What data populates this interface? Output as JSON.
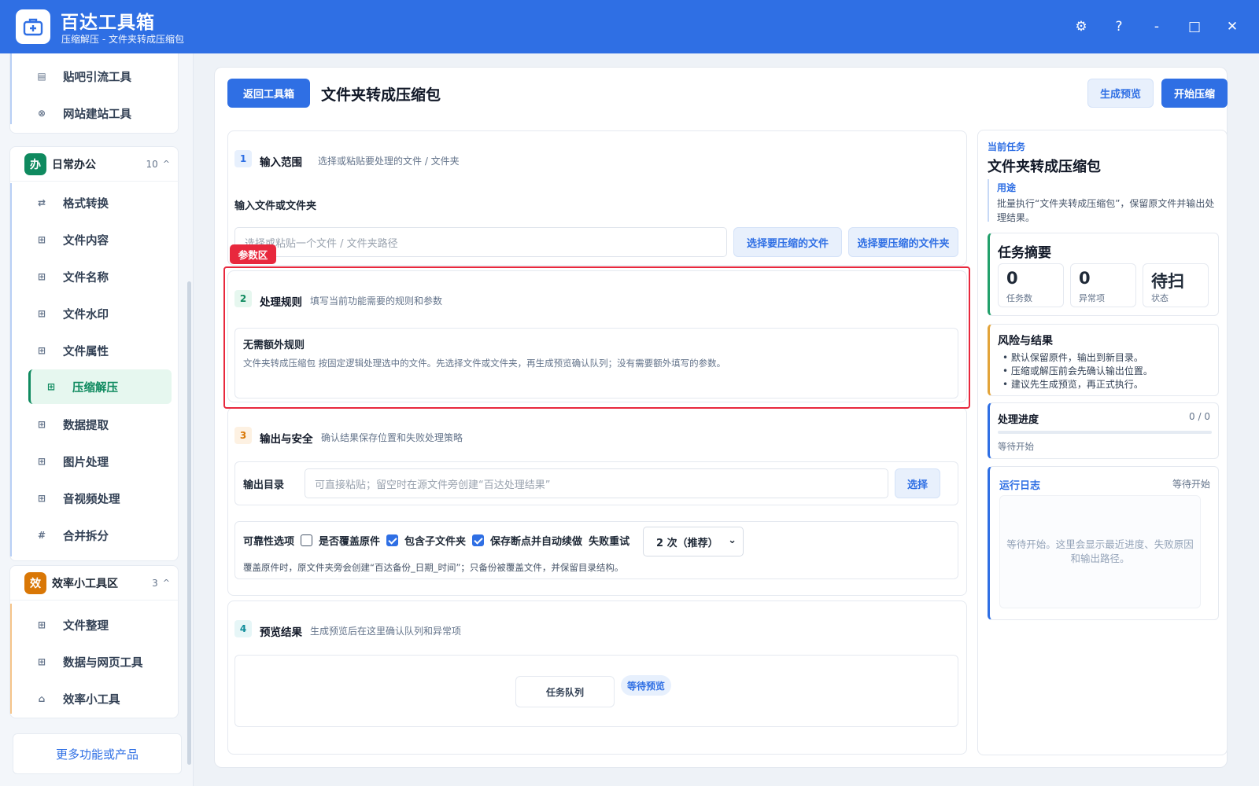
{
  "app": {
    "title": "百达工具箱",
    "subtitle": "压缩解压 - 文件夹转成压缩包",
    "controls": {
      "settings": "⚙",
      "help": "?",
      "minimize": "-",
      "maximize": "□",
      "close": "✕"
    }
  },
  "sidebar": {
    "top_items": [
      {
        "label": "贴吧引流工具",
        "icon": "▤"
      },
      {
        "label": "网站建站工具",
        "icon": "⊗"
      }
    ],
    "groups": [
      {
        "badge": "办",
        "badge_color": "#0f8a5f",
        "name": "日常办公",
        "count": "10",
        "caret": "^",
        "items": [
          {
            "label": "格式转换",
            "icon": "⇄"
          },
          {
            "label": "文件内容",
            "icon": "⊞"
          },
          {
            "label": "文件名称",
            "icon": "⊞"
          },
          {
            "label": "文件水印",
            "icon": "⊞"
          },
          {
            "label": "文件属性",
            "icon": "⊞"
          },
          {
            "label": "压缩解压",
            "icon": "⊞",
            "active": true
          },
          {
            "label": "数据提取",
            "icon": "⊞"
          },
          {
            "label": "图片处理",
            "icon": "⊞"
          },
          {
            "label": "音视频处理",
            "icon": "⊞"
          },
          {
            "label": "合并拆分",
            "icon": "#"
          }
        ]
      },
      {
        "badge": "效",
        "badge_color": "#d97706",
        "name": "效率小工具区",
        "count": "3",
        "caret": "^",
        "items": [
          {
            "label": "文件整理",
            "icon": "⊞"
          },
          {
            "label": "数据与网页工具",
            "icon": "⊞"
          },
          {
            "label": "效率小工具",
            "icon": "⌂"
          }
        ]
      }
    ],
    "more": "更多功能或产品"
  },
  "main": {
    "back_button": "返回工具箱",
    "title": "文件夹转成压缩包",
    "preview_button": "生成预览",
    "start_button": "开始压缩",
    "section1": {
      "num": "1",
      "title": "输入范围",
      "desc": "选择或粘贴要处理的文件 / 文件夹",
      "field_label": "输入文件或文件夹",
      "placeholder": "选择或粘贴一个文件 / 文件夹路径",
      "pick_file": "选择要压缩的文件",
      "pick_folder": "选择要压缩的文件夹"
    },
    "highlight_tag": "参数区",
    "section2": {
      "num": "2",
      "title": "处理规则",
      "desc": "填写当前功能需要的规则和参数",
      "rule_title": "无需额外规则",
      "rule_desc": "文件夹转成压缩包 按固定逻辑处理选中的文件。先选择文件或文件夹，再生成预览确认队列；没有需要额外填写的参数。"
    },
    "section3": {
      "num": "3",
      "title": "输出与安全",
      "desc": "确认结果保存位置和失败处理策略",
      "output_label": "输出目录",
      "output_placeholder": "可直接粘贴；留空时在源文件旁创建“百达处理结果”",
      "choose": "选择",
      "reliability_label": "可靠性选项",
      "opt_overwrite": "是否覆盖原件",
      "opt_subfolders": "包含子文件夹",
      "opt_resume": "保存断点并自动续做",
      "retry_label": "失败重试",
      "retry_value": "2 次（推荐）",
      "note": "覆盖原件时，原文件夹旁会创建“百达备份_日期_时间”；只备份被覆盖文件，并保留目录结构。"
    },
    "section4": {
      "num": "4",
      "title": "预览结果",
      "desc": "生成预览后在这里确认队列和异常项",
      "queue_label": "任务队列",
      "status_pill": "等待预览"
    }
  },
  "panel": {
    "current_task_label": "当前任务",
    "task_title": "文件夹转成压缩包",
    "usage_label": "用途",
    "usage_text": "批量执行“文件夹转成压缩包”，保留原文件并输出处理结果。",
    "summary_title": "任务摘要",
    "stats": [
      {
        "value": "0",
        "label": "任务数"
      },
      {
        "value": "0",
        "label": "异常项"
      },
      {
        "value": "待扫",
        "label": "状态"
      }
    ],
    "risk_title": "风险与结果",
    "risks": [
      "默认保留原件，输出到新目录。",
      "压缩或解压前会先确认输出位置。",
      "建议先生成预览，再正式执行。"
    ],
    "progress_title": "处理进度",
    "progress_count": "0 / 0",
    "progress_fraction": 0,
    "progress_status": "等待开始",
    "log_title": "运行日志",
    "log_status": "等待开始",
    "log_text": "等待开始。这里会显示最近进度、失败原因和输出路径。"
  }
}
